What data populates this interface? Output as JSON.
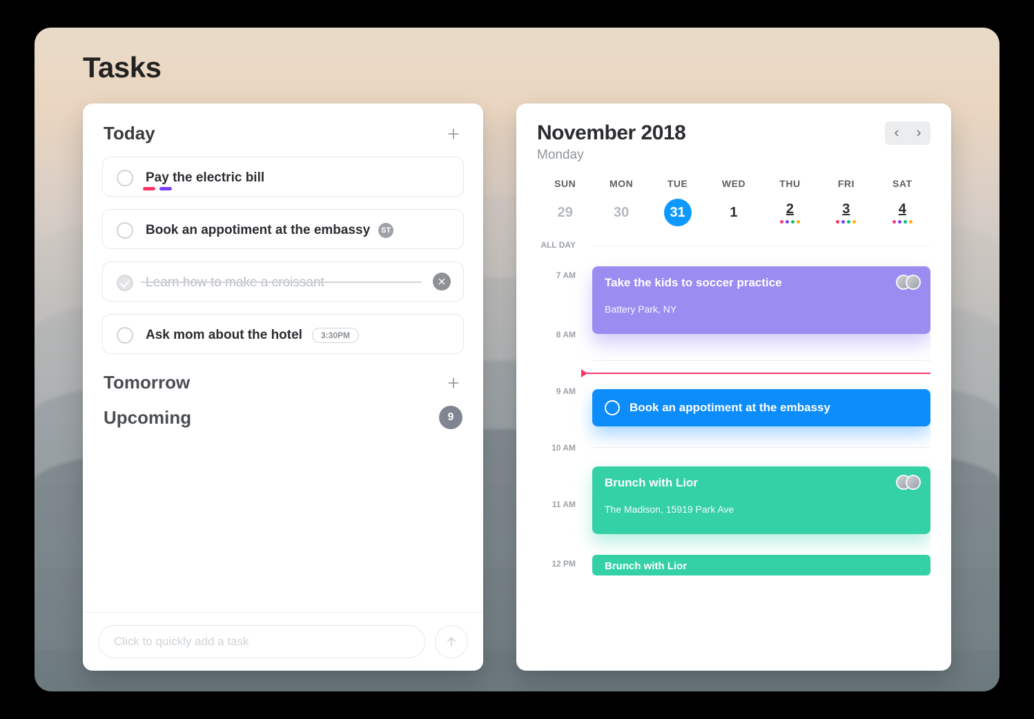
{
  "page_title": "Tasks",
  "tasks_panel": {
    "today": {
      "title": "Today",
      "items": [
        {
          "text": "Pay the electric bill",
          "done": false,
          "dots": [
            "pink",
            "purple"
          ]
        },
        {
          "text": "Book an appotiment at the embassy",
          "done": false,
          "st_badge": "ST"
        },
        {
          "text": "Learn how to make a croissant",
          "done": true
        },
        {
          "text": "Ask mom about the hotel",
          "done": false,
          "time": "3:30PM"
        }
      ]
    },
    "tomorrow": {
      "title": "Tomorrow"
    },
    "upcoming": {
      "title": "Upcoming",
      "count": "9"
    },
    "quick_add_placeholder": "Click to quickly add a task"
  },
  "calendar": {
    "month_year": "November 2018",
    "weekday": "Monday",
    "dow": [
      "SUN",
      "MON",
      "TUE",
      "WED",
      "THU",
      "FRI",
      "SAT"
    ],
    "dates": [
      {
        "n": "29",
        "dim": true
      },
      {
        "n": "30",
        "dim": true
      },
      {
        "n": "31",
        "today": true
      },
      {
        "n": "1"
      },
      {
        "n": "2",
        "dots": [
          "pk",
          "pr",
          "gn",
          "yl"
        ]
      },
      {
        "n": "3",
        "dots": [
          "pk",
          "pr",
          "gn",
          "yl"
        ]
      },
      {
        "n": "4",
        "dots": [
          "pk",
          "pr",
          "gn",
          "yl"
        ]
      }
    ],
    "allday_label": "ALL DAY",
    "hours": [
      "7 AM",
      "8 AM",
      "9 AM",
      "10 AM",
      "11 AM",
      "12 PM"
    ],
    "events": [
      {
        "kind": "purple",
        "title": "Take the kids to soccer practice",
        "loc": "Battery Park, NY",
        "avatars": 2
      },
      {
        "kind": "blue",
        "title": "Book an appotiment at the embassy"
      },
      {
        "kind": "teal",
        "title": "Brunch with Lior",
        "loc": "The Madison, 15919 Park Ave",
        "avatars": 2
      },
      {
        "kind": "teal-thin",
        "title": "Brunch with Lior"
      }
    ]
  }
}
